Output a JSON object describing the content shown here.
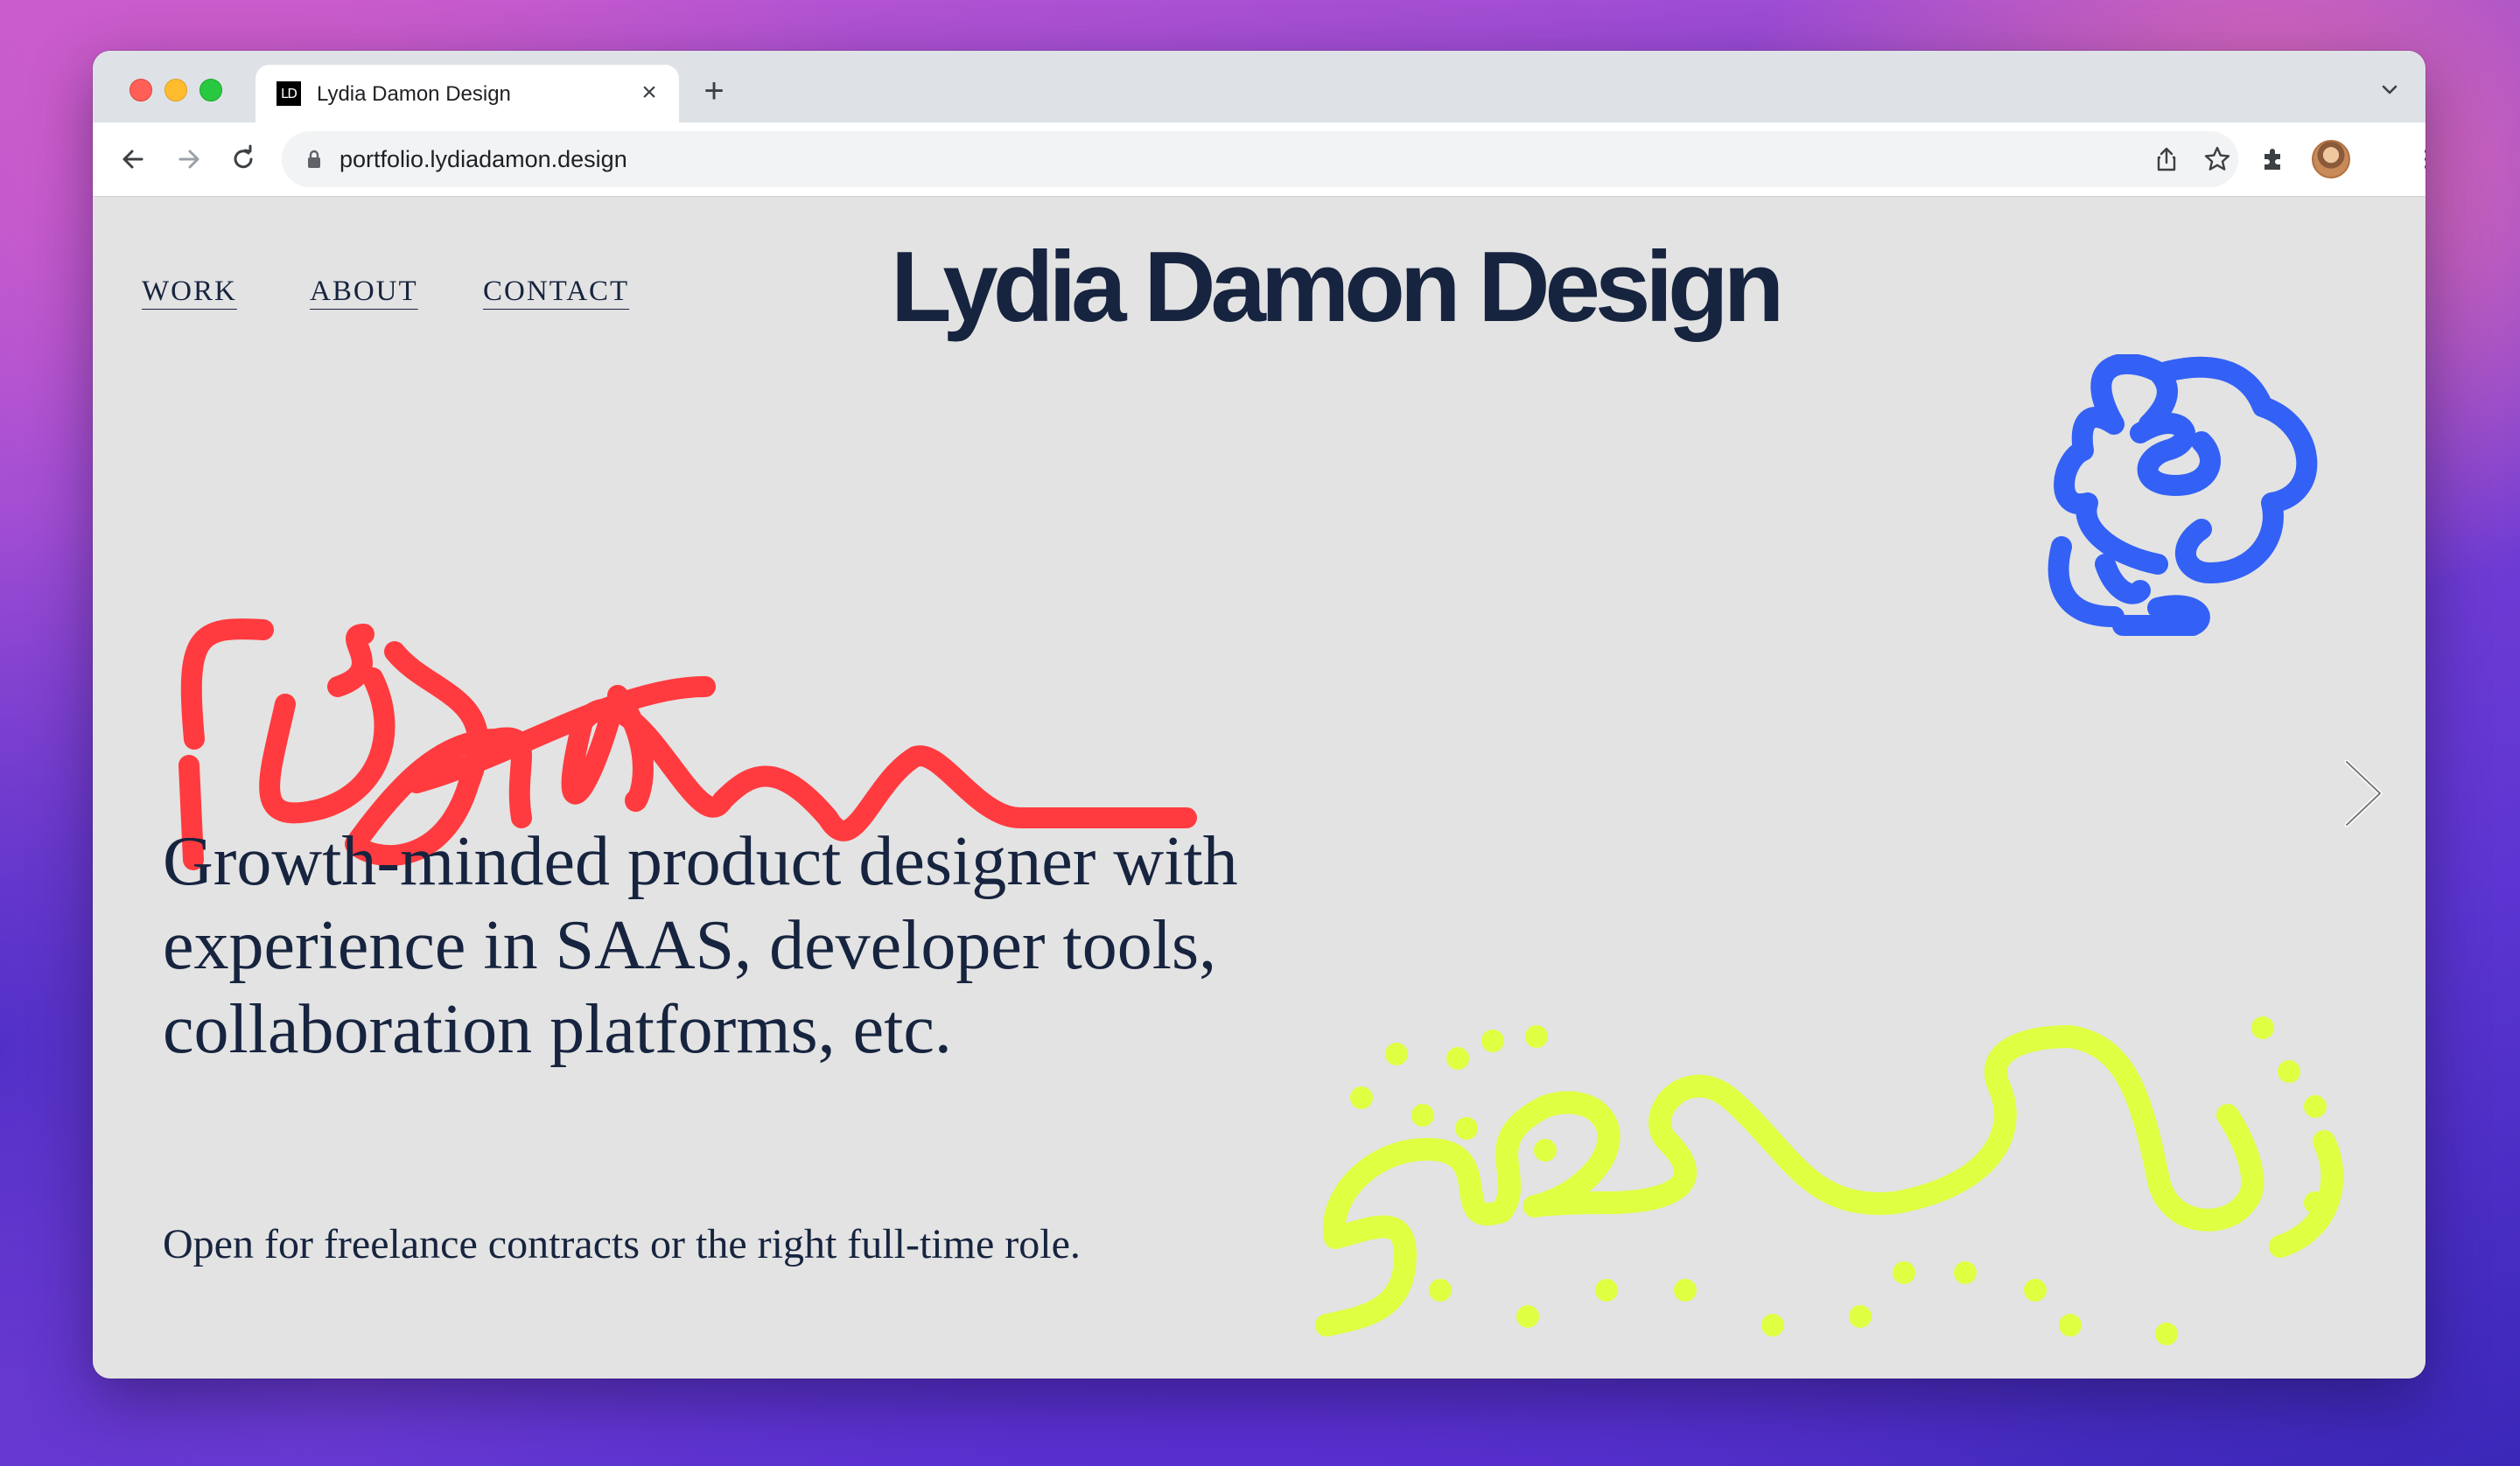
{
  "browser": {
    "tab": {
      "favicon_text": "LD",
      "title": "Lydia Damon Design",
      "close_glyph": "×"
    },
    "new_tab_glyph": "+",
    "address_bar": {
      "url": "portfolio.lydiadamon.design"
    },
    "icons": [
      "back-icon",
      "forward-icon",
      "reload-icon",
      "lock-icon",
      "share-icon",
      "bookmark-star-icon",
      "extensions-icon",
      "side-panel-icon",
      "profile-avatar",
      "more-menu-icon",
      "tab-dropdown-icon"
    ]
  },
  "site": {
    "nav": [
      {
        "label": "WORK"
      },
      {
        "label": "ABOUT"
      },
      {
        "label": "CONTACT"
      }
    ],
    "title": "Lydia Damon Design",
    "headline": "Growth-minded product designer with experience in SAAS, developer tools, collaboration platforms, etc.",
    "subline": "Open for freelance contracts or the right full-time role.",
    "colors": {
      "text": "#17243f",
      "background": "#e3e3e3",
      "red_scribble": "#ff3b3f",
      "blue_scribble": "#3361f5",
      "yellow_scribble": "#dfff42"
    }
  }
}
